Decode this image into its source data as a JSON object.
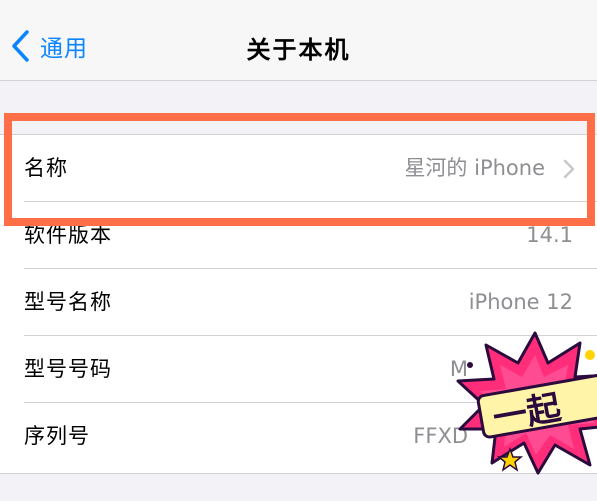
{
  "nav": {
    "back_label": "通用",
    "title": "关于本机"
  },
  "rows": [
    {
      "label": "名称",
      "value": "星河的 iPhone",
      "chevron": true
    },
    {
      "label": "软件版本",
      "value": "14.1"
    },
    {
      "label": "型号名称",
      "value": "iPhone 12"
    },
    {
      "label": "型号号码",
      "value": "M"
    },
    {
      "label": "序列号",
      "value": "FFXD"
    }
  ],
  "sticker": {
    "text": "一起"
  },
  "colors": {
    "accent": "#0a84ff",
    "highlight": "#ff6f47",
    "background": "#f2f2f7",
    "secondary_text": "#8e8e93"
  }
}
